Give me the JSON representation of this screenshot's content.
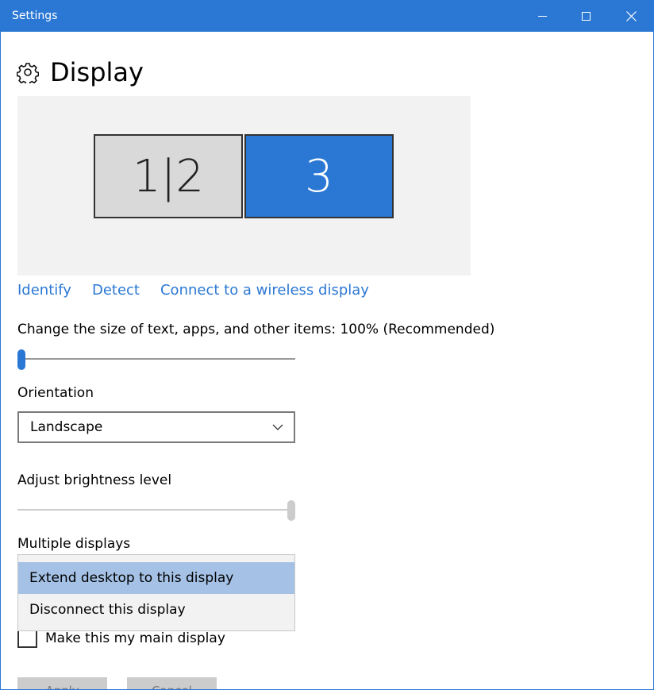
{
  "window": {
    "title": "Settings"
  },
  "header": {
    "title": "Display",
    "icon": "gear-icon"
  },
  "monitors": [
    {
      "label": "1|2",
      "selected": false
    },
    {
      "label": "3",
      "selected": true
    }
  ],
  "links": {
    "identify": "Identify",
    "detect": "Detect",
    "wireless": "Connect to a wireless display"
  },
  "scaling": {
    "label": "Change the size of text, apps, and other items: 100% (Recommended)",
    "value_percent": 0
  },
  "orientation": {
    "label": "Orientation",
    "selected": "Landscape"
  },
  "brightness": {
    "label": "Adjust brightness level",
    "value_percent": 100
  },
  "multiple_displays": {
    "label": "Multiple displays",
    "options": [
      "Extend desktop to this display",
      "Disconnect this display"
    ],
    "highlighted_index": 0
  },
  "main_display": {
    "label": "Make this my main display",
    "checked": false
  },
  "buttons": {
    "apply": "Apply",
    "cancel": "Cancel"
  },
  "colors": {
    "accent": "#2b78d4",
    "highlight": "#a5c2e6",
    "preview_bg": "#f2f2f2"
  }
}
